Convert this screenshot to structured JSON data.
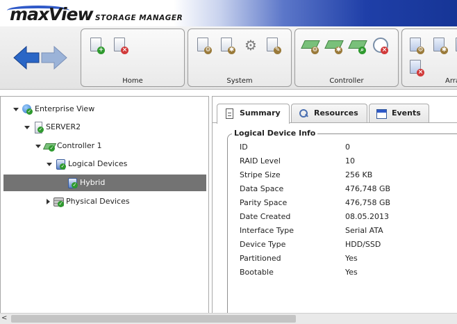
{
  "app": {
    "logo_main": "maxView",
    "logo_sub": "STORAGE MANAGER"
  },
  "colors": {
    "accent": "#1f3fa8",
    "selected_row": "#737373",
    "ok_badge": "#2f9a2f",
    "error_badge": "#d13a3a"
  },
  "toolbar": {
    "groups": [
      {
        "label": "Home"
      },
      {
        "label": "System"
      },
      {
        "label": "Controller"
      },
      {
        "label": "Arra"
      }
    ]
  },
  "tree": {
    "items": [
      {
        "label": "Enterprise View"
      },
      {
        "label": "SERVER2"
      },
      {
        "label": "Controller 1"
      },
      {
        "label": "Logical Devices"
      },
      {
        "label": "Hybrid"
      },
      {
        "label": "Physical Devices"
      }
    ]
  },
  "tabs": [
    {
      "label": "Summary"
    },
    {
      "label": "Resources"
    },
    {
      "label": "Events"
    }
  ],
  "info": {
    "legend": "Logical Device Info",
    "rows": [
      {
        "label": "ID",
        "value": "0"
      },
      {
        "label": "RAID Level",
        "value": "10"
      },
      {
        "label": "Stripe Size",
        "value": "256 KB"
      },
      {
        "label": "Data Space",
        "value": "476,748 GB"
      },
      {
        "label": "Parity Space",
        "value": "476,758 GB"
      },
      {
        "label": "Date Created",
        "value": "08.05.2013"
      },
      {
        "label": "Interface Type",
        "value": "Serial ATA"
      },
      {
        "label": "Device Type",
        "value": "HDD/SSD"
      },
      {
        "label": "Partitioned",
        "value": "Yes"
      },
      {
        "label": "Bootable",
        "value": "Yes"
      }
    ]
  },
  "scrollbar": {
    "left_arrow": "<"
  }
}
